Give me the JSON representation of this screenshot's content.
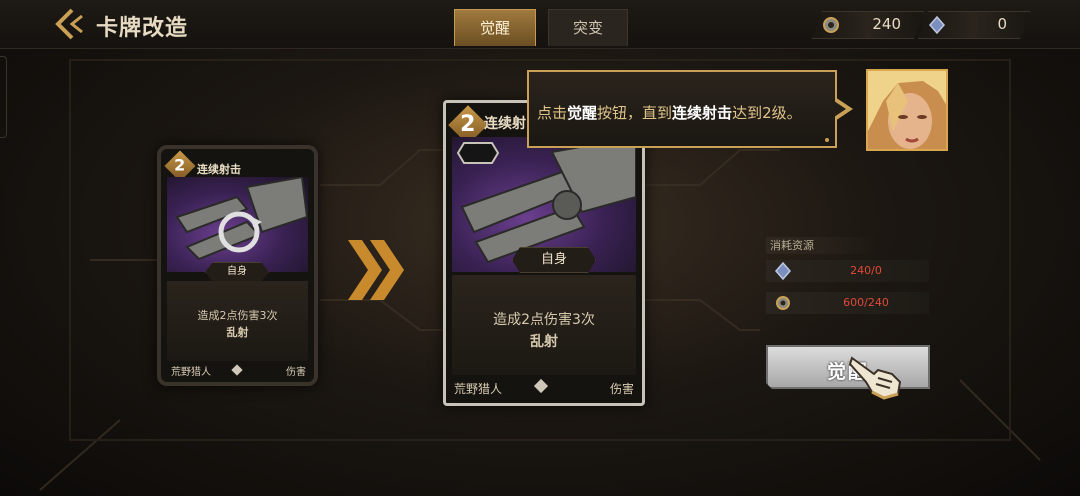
{
  "header": {
    "title": "卡牌改造",
    "tabs": [
      {
        "label": "觉醒",
        "active": true
      },
      {
        "label": "突变",
        "active": false
      }
    ],
    "resources": [
      {
        "icon": "gear-resource-icon",
        "value": "240"
      },
      {
        "icon": "crystal-resource-icon",
        "value": "0"
      }
    ]
  },
  "card_before": {
    "cost": "2",
    "name": "连续射击",
    "badge": "自身",
    "desc_line1": "造成2点伤害3次",
    "desc_line2": "乱射",
    "footer_left": "荒野猎人",
    "footer_right": "伤害"
  },
  "card_after": {
    "cost": "2",
    "name": "连续射",
    "badge": "自身",
    "desc_line1": "造成2点伤害3次",
    "desc_line2": "乱射",
    "footer_left": "荒野猎人",
    "footer_right": "伤害"
  },
  "tooltip": {
    "part1": "点击",
    "part2": "觉醒",
    "part3": "按钮，直到",
    "part4": "连续射击",
    "part5": "达到2级。"
  },
  "cost_panel": {
    "title": "消耗资源",
    "rows": [
      {
        "icon": "crystal-resource-icon",
        "value": "240/0"
      },
      {
        "icon": "gear-resource-icon",
        "value": "600/240"
      }
    ]
  },
  "action": {
    "awaken_label": "觉醒"
  },
  "colors": {
    "accent_gold": "#c9a055",
    "insufficient_red": "#e04a3a",
    "active_tab": "#a07a3e"
  }
}
